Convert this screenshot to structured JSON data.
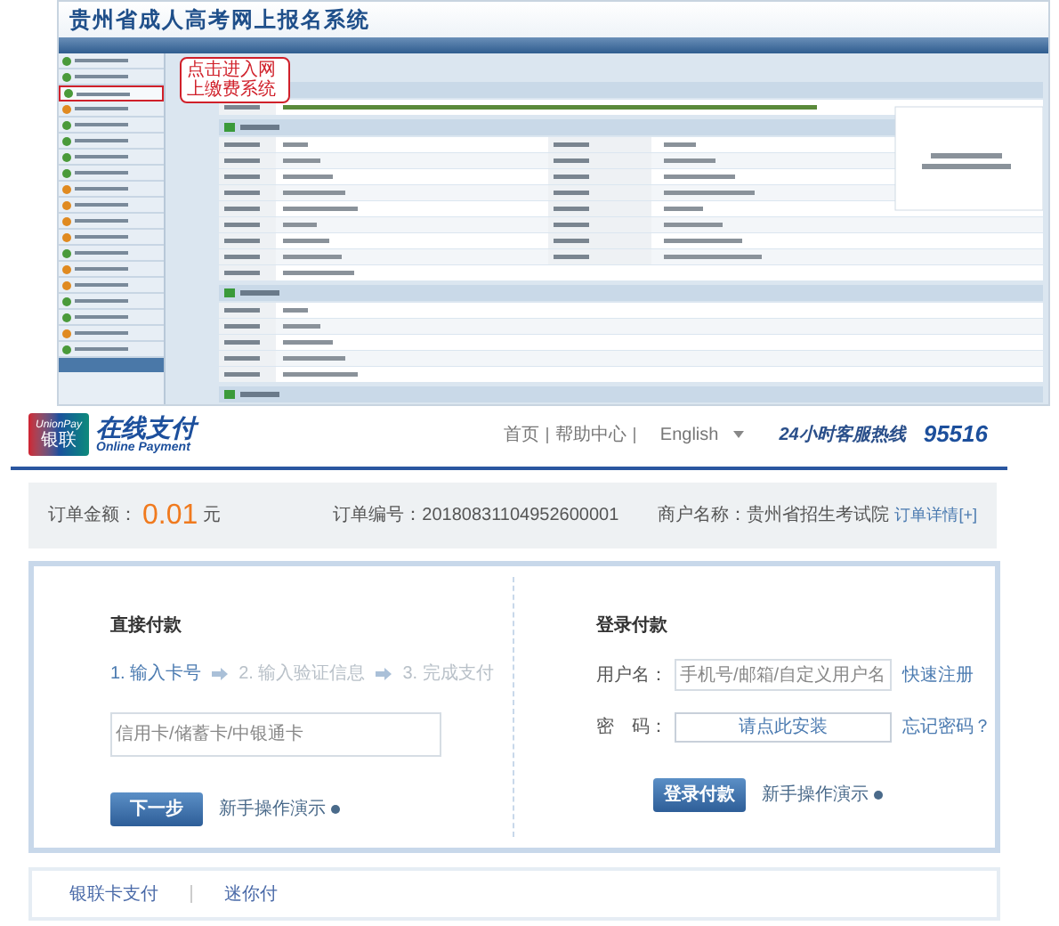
{
  "registration_screen": {
    "title": "贵州省成人高考网上报名系统",
    "callout": "点击进入网上缴费系统",
    "sidebar_items": [
      {
        "color": "#4a9a3a",
        "selected": false
      },
      {
        "color": "#4a9a3a",
        "selected": false
      },
      {
        "color": "#4a9a3a",
        "selected": true
      },
      {
        "color": "#e08a20",
        "selected": false
      },
      {
        "color": "#4a9a3a",
        "selected": false
      },
      {
        "color": "#4a9a3a",
        "selected": false
      },
      {
        "color": "#4a9a3a",
        "selected": false
      },
      {
        "color": "#4a9a3a",
        "selected": false
      },
      {
        "color": "#e08a20",
        "selected": false
      },
      {
        "color": "#e08a20",
        "selected": false
      },
      {
        "color": "#e08a20",
        "selected": false
      },
      {
        "color": "#e08a20",
        "selected": false
      },
      {
        "color": "#4a9a3a",
        "selected": false
      },
      {
        "color": "#e08a20",
        "selected": false
      },
      {
        "color": "#e08a20",
        "selected": false
      },
      {
        "color": "#4a9a3a",
        "selected": false
      },
      {
        "color": "#4a9a3a",
        "selected": false
      },
      {
        "color": "#e08a20",
        "selected": false
      },
      {
        "color": "#4a9a3a",
        "selected": false
      }
    ]
  },
  "header": {
    "badge_top": "UnionPay",
    "badge_bottom": "银联",
    "logo_cn": "在线支付",
    "logo_en": "Online Payment",
    "links": [
      "首页",
      "帮助中心"
    ],
    "language": "English",
    "hotline_label": "24小时客服热线",
    "hotline": "95516"
  },
  "order": {
    "amount_label": "订单金额：",
    "amount": "0.01",
    "currency": "元",
    "number_label": "订单编号：",
    "number": "20180831104952600001",
    "merchant_label": "商户名称：",
    "merchant": "贵州省招生考试院",
    "details": "订单详情[+]"
  },
  "direct_payment": {
    "title": "直接付款",
    "steps": [
      {
        "label": "1. 输入卡号",
        "selected": true
      },
      {
        "label": "2. 输入验证信息",
        "selected": false
      },
      {
        "label": "3. 完成支付",
        "selected": false
      }
    ],
    "card_placeholder": "信用卡/储蓄卡/中银通卡",
    "next": "下一步",
    "guide": "新手操作演示"
  },
  "login_payment": {
    "title": "登录付款",
    "username_label": "用户名：",
    "username_placeholder": "手机号/邮箱/自定义用户名",
    "register": "快速注册",
    "password_label": "密　码：",
    "password_hint": "请点此安装",
    "forgot": "忘记密码？",
    "submit": "登录付款",
    "guide": "新手操作演示"
  },
  "footer_tabs": [
    "银联卡支付",
    "迷你付"
  ]
}
